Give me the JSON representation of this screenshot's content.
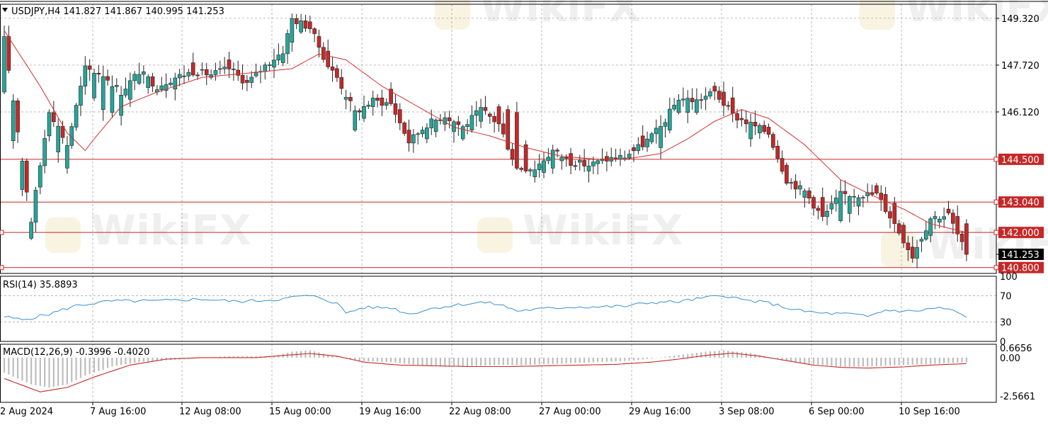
{
  "header": {
    "symbol_info": "USDJPY,H4  141.827 141.867 140.995 141.253",
    "rsi_label": "RSI(14) 35.8893",
    "macd_label": "MACD(12,26,9) -0.3996 -0.4020"
  },
  "watermark": "WikiFX",
  "colors": {
    "bull": "#26a69a",
    "bear": "#c62828",
    "ma_line": "#d32f2f",
    "level_line": "#c62828",
    "rsi_line": "#3a8fd0",
    "macd_signal": "#c62828",
    "macd_hist": "#bdbdbd",
    "grid": "#9e9e9e"
  },
  "chart_data": [
    {
      "type": "candlestick",
      "title": "USDJPY,H4",
      "ylim": [
        140.6,
        149.8
      ],
      "y_ticks": [
        "149.320",
        "147.720",
        "146.120",
        "144.500",
        "143.040",
        "142.000",
        "141.253",
        "140.800"
      ],
      "x_tick_labels": [
        "2 Aug 2024",
        "7 Aug 16:00",
        "12 Aug 08:00",
        "15 Aug 00:00",
        "19 Aug 16:00",
        "22 Aug 08:00",
        "27 Aug 00:00",
        "29 Aug 16:00",
        "3 Sep 08:00",
        "6 Sep 00:00",
        "10 Sep 16:00"
      ],
      "horizontal_levels": [
        144.5,
        143.04,
        142.0,
        140.8
      ],
      "current_price": 141.253,
      "ohlc_anchors": [
        [
          0,
          146.8,
          148.6
        ],
        [
          6,
          141.8,
          142.4
        ],
        [
          10,
          145.3,
          146.2
        ],
        [
          14,
          144.2,
          145.0
        ],
        [
          18,
          147.0,
          147.6
        ],
        [
          22,
          146.2,
          147.4
        ],
        [
          26,
          146.0,
          146.8
        ],
        [
          30,
          147.1,
          147.5
        ],
        [
          34,
          146.8,
          147.0
        ],
        [
          38,
          146.9,
          147.3
        ],
        [
          42,
          147.8,
          147.5
        ],
        [
          46,
          147.3,
          147.4
        ],
        [
          50,
          147.9,
          147.6
        ],
        [
          54,
          147.2,
          147.1
        ],
        [
          58,
          147.5,
          147.7
        ],
        [
          62,
          147.8,
          148.2
        ],
        [
          64,
          148.5,
          149.3
        ],
        [
          68,
          149.2,
          149.0
        ],
        [
          72,
          148.2,
          147.7
        ],
        [
          74,
          147.6,
          147.3
        ],
        [
          78,
          145.5,
          146.1
        ],
        [
          82,
          146.3,
          146.5
        ],
        [
          86,
          146.9,
          146.4
        ],
        [
          90,
          145.5,
          145.1
        ],
        [
          94,
          145.2,
          145.7
        ],
        [
          98,
          145.7,
          146.0
        ],
        [
          102,
          145.2,
          145.6
        ],
        [
          106,
          145.8,
          146.2
        ],
        [
          110,
          146.3,
          145.7
        ],
        [
          114,
          146.1,
          144.2
        ],
        [
          118,
          143.9,
          144.2
        ],
        [
          122,
          144.2,
          144.8
        ],
        [
          126,
          144.7,
          144.4
        ],
        [
          130,
          144.1,
          144.3
        ],
        [
          134,
          144.6,
          144.5
        ],
        [
          138,
          144.5,
          144.6
        ],
        [
          142,
          145.3,
          145.0
        ],
        [
          146,
          144.9,
          145.6
        ],
        [
          150,
          146.1,
          146.6
        ],
        [
          154,
          146.1,
          146.5
        ],
        [
          158,
          147.0,
          146.8
        ],
        [
          162,
          146.6,
          146.0
        ],
        [
          166,
          145.2,
          145.7
        ],
        [
          170,
          145.6,
          145.4
        ],
        [
          174,
          144.3,
          143.8
        ],
        [
          178,
          143.2,
          143.4
        ],
        [
          182,
          143.2,
          142.5
        ],
        [
          186,
          142.4,
          143.3
        ],
        [
          190,
          142.9,
          143.3
        ],
        [
          194,
          143.6,
          143.3
        ],
        [
          198,
          143.0,
          142.3
        ],
        [
          202,
          141.5,
          141.2
        ],
        [
          206,
          141.9,
          142.5
        ],
        [
          210,
          142.8,
          142.6
        ],
        [
          214,
          142.3,
          141.253
        ]
      ],
      "ma_anchors": [
        [
          0,
          148.9
        ],
        [
          8,
          147.0
        ],
        [
          14,
          145.4
        ],
        [
          18,
          144.8
        ],
        [
          20,
          145.2
        ],
        [
          26,
          146.3
        ],
        [
          34,
          146.8
        ],
        [
          44,
          147.3
        ],
        [
          58,
          147.5
        ],
        [
          64,
          147.6
        ],
        [
          70,
          148.1
        ],
        [
          76,
          147.9
        ],
        [
          84,
          147.0
        ],
        [
          92,
          146.3
        ],
        [
          100,
          145.6
        ],
        [
          108,
          145.3
        ],
        [
          116,
          144.9
        ],
        [
          124,
          144.6
        ],
        [
          132,
          144.5
        ],
        [
          138,
          144.5
        ],
        [
          146,
          144.7
        ],
        [
          152,
          145.2
        ],
        [
          158,
          145.8
        ],
        [
          164,
          146.2
        ],
        [
          170,
          145.9
        ],
        [
          178,
          145.0
        ],
        [
          186,
          143.8
        ],
        [
          194,
          143.2
        ],
        [
          200,
          142.8
        ],
        [
          206,
          142.3
        ],
        [
          214,
          142.0
        ]
      ]
    },
    {
      "type": "line",
      "title": "RSI(14) 35.8893",
      "ylim": [
        0,
        100
      ],
      "y_ticks": [
        100,
        70,
        30,
        0
      ],
      "anchors": [
        [
          0,
          38
        ],
        [
          4,
          33
        ],
        [
          10,
          42
        ],
        [
          16,
          55
        ],
        [
          24,
          62
        ],
        [
          34,
          62
        ],
        [
          44,
          65
        ],
        [
          52,
          61
        ],
        [
          62,
          65
        ],
        [
          66,
          70
        ],
        [
          70,
          68
        ],
        [
          74,
          58
        ],
        [
          76,
          44
        ],
        [
          80,
          52
        ],
        [
          86,
          52
        ],
        [
          90,
          42
        ],
        [
          96,
          52
        ],
        [
          102,
          57
        ],
        [
          106,
          60
        ],
        [
          110,
          57
        ],
        [
          114,
          47
        ],
        [
          120,
          50
        ],
        [
          126,
          53
        ],
        [
          132,
          53
        ],
        [
          138,
          54
        ],
        [
          144,
          60
        ],
        [
          150,
          61
        ],
        [
          156,
          67
        ],
        [
          160,
          71
        ],
        [
          164,
          64
        ],
        [
          170,
          59
        ],
        [
          176,
          48
        ],
        [
          182,
          43
        ],
        [
          188,
          42
        ],
        [
          192,
          38
        ],
        [
          196,
          48
        ],
        [
          202,
          46
        ],
        [
          208,
          52
        ],
        [
          212,
          45
        ],
        [
          214,
          36
        ]
      ]
    },
    {
      "type": "bar+line",
      "title": "MACD(12,26,9) -0.3996 -0.4020",
      "ylim": [
        -3.0,
        0.9
      ],
      "y_ticks": [
        0.6656,
        0.0,
        -2.5661
      ],
      "histogram_anchors": [
        [
          0,
          -1.0
        ],
        [
          6,
          -1.8
        ],
        [
          10,
          -2.0
        ],
        [
          14,
          -1.8
        ],
        [
          18,
          -1.2
        ],
        [
          24,
          -0.6
        ],
        [
          30,
          -0.3
        ],
        [
          40,
          -0.1
        ],
        [
          50,
          0.1
        ],
        [
          60,
          0.1
        ],
        [
          64,
          0.4
        ],
        [
          68,
          0.5
        ],
        [
          72,
          0.2
        ],
        [
          78,
          -0.2
        ],
        [
          86,
          -0.3
        ],
        [
          92,
          -0.5
        ],
        [
          100,
          -0.6
        ],
        [
          110,
          -0.5
        ],
        [
          116,
          -0.5
        ],
        [
          124,
          -0.4
        ],
        [
          132,
          -0.3
        ],
        [
          140,
          -0.2
        ],
        [
          148,
          0.1
        ],
        [
          156,
          0.4
        ],
        [
          160,
          0.5
        ],
        [
          166,
          0.3
        ],
        [
          172,
          -0.1
        ],
        [
          178,
          -0.4
        ],
        [
          186,
          -0.6
        ],
        [
          192,
          -0.6
        ],
        [
          200,
          -0.5
        ],
        [
          208,
          -0.4
        ],
        [
          214,
          -0.3
        ]
      ],
      "signal_anchors": [
        [
          0,
          -1.4
        ],
        [
          8,
          -2.3
        ],
        [
          14,
          -2.0
        ],
        [
          20,
          -1.3
        ],
        [
          28,
          -0.5
        ],
        [
          36,
          -0.1
        ],
        [
          44,
          0.0
        ],
        [
          56,
          0.0
        ],
        [
          62,
          0.15
        ],
        [
          68,
          0.28
        ],
        [
          74,
          0.1
        ],
        [
          80,
          -0.3
        ],
        [
          88,
          -0.5
        ],
        [
          96,
          -0.55
        ],
        [
          104,
          -0.6
        ],
        [
          112,
          -0.6
        ],
        [
          120,
          -0.55
        ],
        [
          128,
          -0.5
        ],
        [
          136,
          -0.45
        ],
        [
          144,
          -0.3
        ],
        [
          150,
          -0.1
        ],
        [
          156,
          0.15
        ],
        [
          162,
          0.3
        ],
        [
          168,
          0.1
        ],
        [
          174,
          -0.2
        ],
        [
          180,
          -0.5
        ],
        [
          186,
          -0.65
        ],
        [
          192,
          -0.7
        ],
        [
          200,
          -0.62
        ],
        [
          206,
          -0.5
        ],
        [
          210,
          -0.45
        ],
        [
          214,
          -0.4
        ]
      ]
    }
  ]
}
